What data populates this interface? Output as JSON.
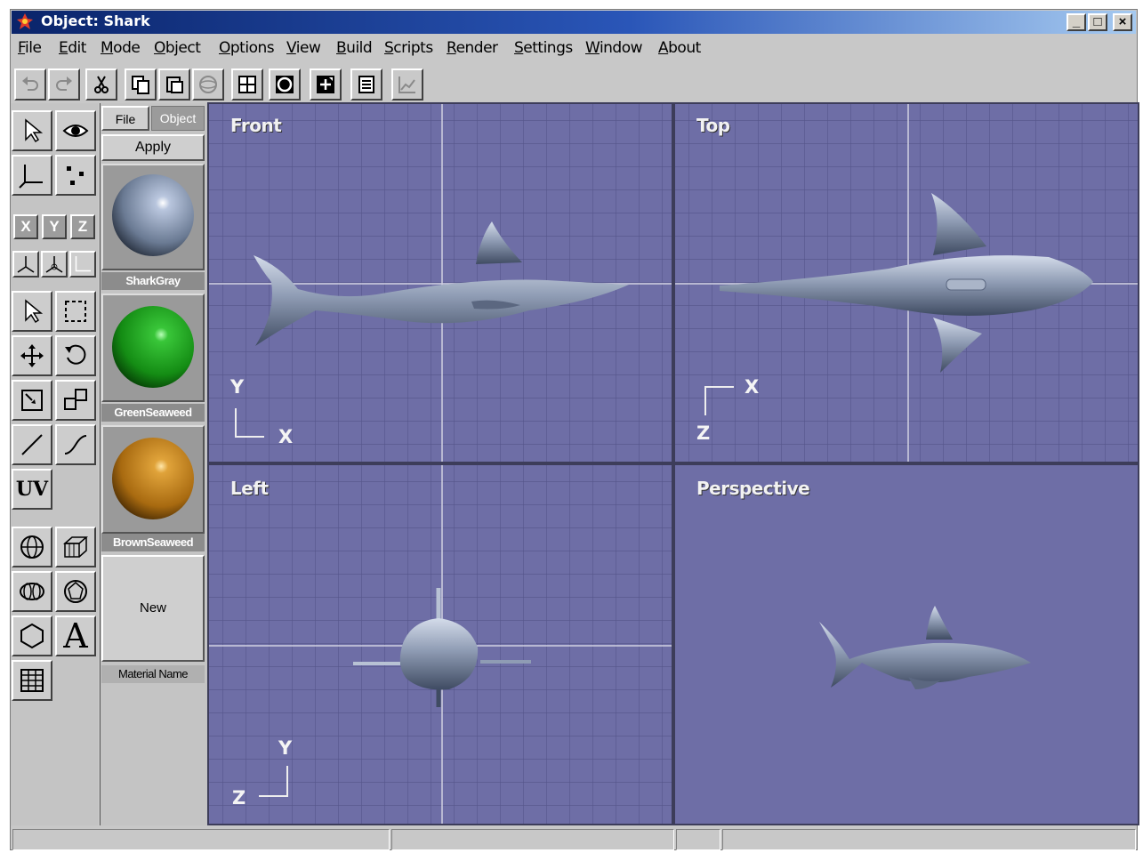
{
  "window": {
    "title": "Object: Shark",
    "min_label": "_",
    "max_label": "□",
    "close_label": "×"
  },
  "menu": [
    "File",
    "Edit",
    "Mode",
    "Object",
    "Options",
    "View",
    "Build",
    "Scripts",
    "Render",
    "Settings",
    "Window",
    "About"
  ],
  "toolbar_icons": [
    "undo-icon",
    "redo-icon",
    "cut-icon",
    "copy-icon",
    "paste-icon",
    "sphere-toggle-icon",
    "grid-view-icon",
    "circle-view-icon",
    "snap-icon",
    "properties-icon",
    "graph-icon"
  ],
  "left_tools": {
    "axis_buttons": [
      "X",
      "Y",
      "Z"
    ],
    "uv_label": "UV",
    "text_tool_label": "A"
  },
  "materials_panel": {
    "tabs": [
      "File",
      "Object"
    ],
    "apply_label": "Apply",
    "materials": [
      {
        "name": "SharkGray",
        "color": "#7f8fa8"
      },
      {
        "name": "GreenSeaweed",
        "color": "#1f9a1f"
      },
      {
        "name": "BrownSeaweed",
        "color": "#b7791d"
      }
    ],
    "new_label": "New",
    "material_name_label": "Material Name"
  },
  "viewports": {
    "front": {
      "label": "Front",
      "axis_a": "Y",
      "axis_b": "X"
    },
    "top": {
      "label": "Top",
      "axis_a": "X",
      "axis_b": "Z"
    },
    "left": {
      "label": "Left",
      "axis_a": "Y",
      "axis_b": "Z"
    },
    "perspective": {
      "label": "Perspective"
    }
  },
  "colors": {
    "viewport_bg": "#6e6ea6",
    "grid": "#5a5a8c",
    "axis_line": "#d0d0e0",
    "shark": "#8796b0"
  }
}
